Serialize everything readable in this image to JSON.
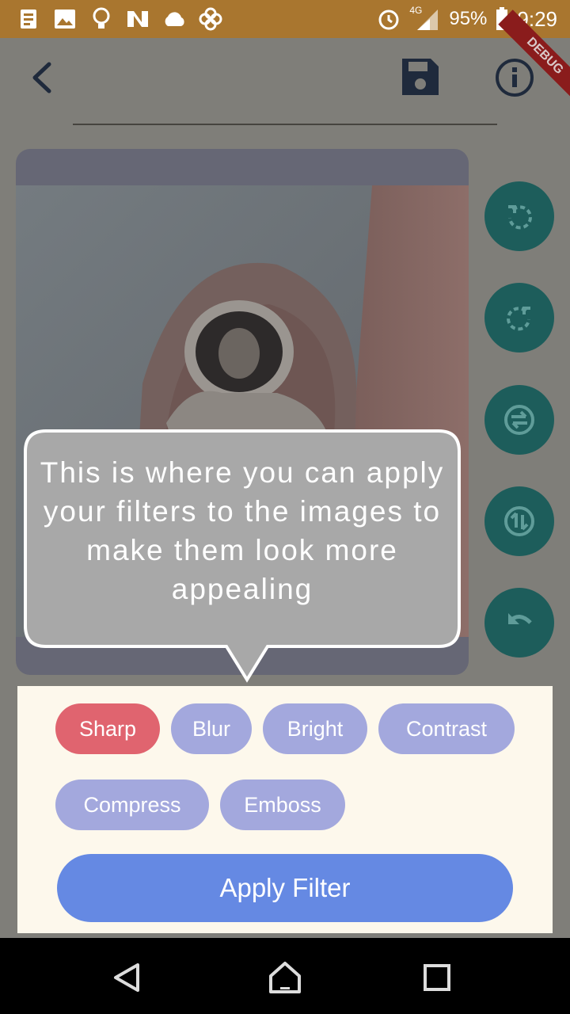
{
  "status_bar": {
    "battery": "95%",
    "time": "9:29",
    "network": "4G",
    "icons": [
      "contacts-icon",
      "image-icon",
      "lightbulb-icon",
      "n-app-icon",
      "cloud-icon",
      "flower-icon",
      "alarm-icon",
      "signal-icon",
      "battery-icon"
    ]
  },
  "app_bar": {
    "icons": [
      "back-arrow-icon",
      "save-icon",
      "info-icon"
    ],
    "debug_banner": "DEBUG"
  },
  "side_actions": [
    "rotate-left-icon",
    "rotate-right-icon",
    "flip-horizontal-icon",
    "flip-vertical-icon",
    "undo-icon"
  ],
  "tooltip": {
    "text": "This is where you can apply your filters to the images to make them look more appealing"
  },
  "filters": {
    "chips": [
      {
        "label": "Sharp",
        "selected": true
      },
      {
        "label": "Blur",
        "selected": false
      },
      {
        "label": "Bright",
        "selected": false
      },
      {
        "label": "Contrast",
        "selected": false
      },
      {
        "label": "Compress",
        "selected": false
      },
      {
        "label": "Emboss",
        "selected": false
      }
    ],
    "apply_label": "Apply Filter"
  },
  "colors": {
    "status_bar": "#a9762f",
    "side_button": "#1d5d5b",
    "chip_active": "#e0646f",
    "chip_inactive": "#a3a8dd",
    "apply_button": "#6589e3",
    "panel": "#fdf8ec"
  },
  "nav_bar": [
    "back-nav-icon",
    "home-nav-icon",
    "recents-nav-icon"
  ]
}
